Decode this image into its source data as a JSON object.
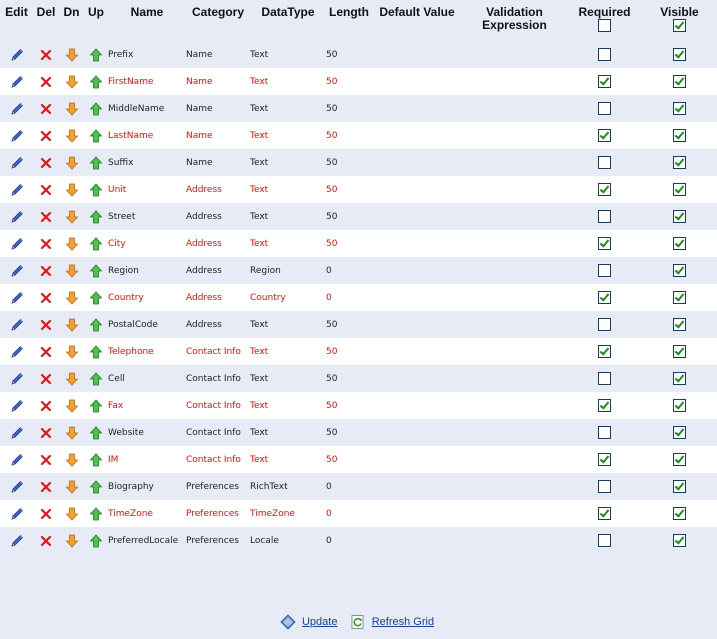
{
  "headers": {
    "edit": "Edit",
    "del": "Del",
    "dn": "Dn",
    "up": "Up",
    "name": "Name",
    "category": "Category",
    "datatype": "DataType",
    "length": "Length",
    "default_value": "Default Value",
    "validation_expression": "Validation Expression",
    "required": "Required",
    "visible": "Visible"
  },
  "colors": {
    "required_text": "#E01010",
    "row_alt": "#E6EBF6",
    "row_white": "#FFFFFF",
    "link": "#1A3E9A"
  },
  "icons": {
    "edit": "pencil-icon",
    "delete": "red-x-icon",
    "down": "orange-arrow-down-icon",
    "up": "green-arrow-up-icon",
    "update": "diamond-update-icon",
    "refresh": "refresh-icon"
  },
  "rows": [
    {
      "name": "Prefix",
      "category": "Name",
      "datatype": "Text",
      "length": "50",
      "required": false,
      "visible": true
    },
    {
      "name": "FirstName",
      "category": "Name",
      "datatype": "Text",
      "length": "50",
      "required": true,
      "visible": true
    },
    {
      "name": "MiddleName",
      "category": "Name",
      "datatype": "Text",
      "length": "50",
      "required": false,
      "visible": true
    },
    {
      "name": "LastName",
      "category": "Name",
      "datatype": "Text",
      "length": "50",
      "required": true,
      "visible": true
    },
    {
      "name": "Suffix",
      "category": "Name",
      "datatype": "Text",
      "length": "50",
      "required": false,
      "visible": true
    },
    {
      "name": "Unit",
      "category": "Address",
      "datatype": "Text",
      "length": "50",
      "required": true,
      "visible": true
    },
    {
      "name": "Street",
      "category": "Address",
      "datatype": "Text",
      "length": "50",
      "required": false,
      "visible": true
    },
    {
      "name": "City",
      "category": "Address",
      "datatype": "Text",
      "length": "50",
      "required": true,
      "visible": true
    },
    {
      "name": "Region",
      "category": "Address",
      "datatype": "Region",
      "length": "0",
      "required": false,
      "visible": true
    },
    {
      "name": "Country",
      "category": "Address",
      "datatype": "Country",
      "length": "0",
      "required": true,
      "visible": true
    },
    {
      "name": "PostalCode",
      "category": "Address",
      "datatype": "Text",
      "length": "50",
      "required": false,
      "visible": true
    },
    {
      "name": "Telephone",
      "category": "Contact Info",
      "datatype": "Text",
      "length": "50",
      "required": true,
      "visible": true
    },
    {
      "name": "Cell",
      "category": "Contact Info",
      "datatype": "Text",
      "length": "50",
      "required": false,
      "visible": true
    },
    {
      "name": "Fax",
      "category": "Contact Info",
      "datatype": "Text",
      "length": "50",
      "required": true,
      "visible": true
    },
    {
      "name": "Website",
      "category": "Contact Info",
      "datatype": "Text",
      "length": "50",
      "required": false,
      "visible": true
    },
    {
      "name": "IM",
      "category": "Contact Info",
      "datatype": "Text",
      "length": "50",
      "required": true,
      "visible": true
    },
    {
      "name": "Biography",
      "category": "Preferences",
      "datatype": "RichText",
      "length": "0",
      "required": false,
      "visible": true
    },
    {
      "name": "TimeZone",
      "category": "Preferences",
      "datatype": "TimeZone",
      "length": "0",
      "required": true,
      "visible": true
    },
    {
      "name": "PreferredLocale",
      "category": "Preferences",
      "datatype": "Locale",
      "length": "0",
      "required": false,
      "visible": true
    }
  ],
  "footer": {
    "update_label": "Update",
    "refresh_label": "Refresh Grid"
  }
}
